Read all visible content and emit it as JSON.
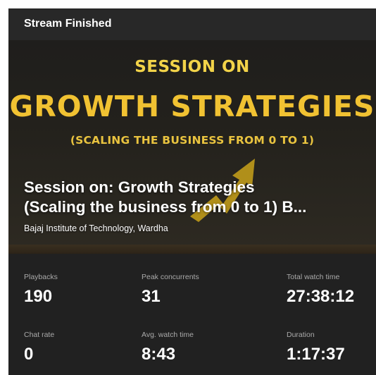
{
  "header": {
    "title": "Stream Finished"
  },
  "thumbnail": {
    "poster_line1": "SESSION ON",
    "poster_line2": "GROWTH STRATEGIES",
    "poster_line3": "(SCALING THE BUSINESS FROM 0 TO 1)",
    "arrow_icon": "trend-up-arrow-icon",
    "accent_color": "#f1c232"
  },
  "stream": {
    "title_line1": "Session on: Growth Strategies",
    "title_line2": "(Scaling the business from 0 to 1) B...",
    "channel": "Bajaj Institute of Technology, Wardha"
  },
  "stats": {
    "playbacks": {
      "label": "Playbacks",
      "value": "190"
    },
    "peak_concurrents": {
      "label": "Peak concurrents",
      "value": "31"
    },
    "total_watch_time": {
      "label": "Total watch time",
      "value": "27:38:12"
    },
    "chat_rate": {
      "label": "Chat rate",
      "value": "0"
    },
    "avg_watch_time": {
      "label": "Avg. watch time",
      "value": "8:43"
    },
    "duration": {
      "label": "Duration",
      "value": "1:17:37"
    }
  }
}
